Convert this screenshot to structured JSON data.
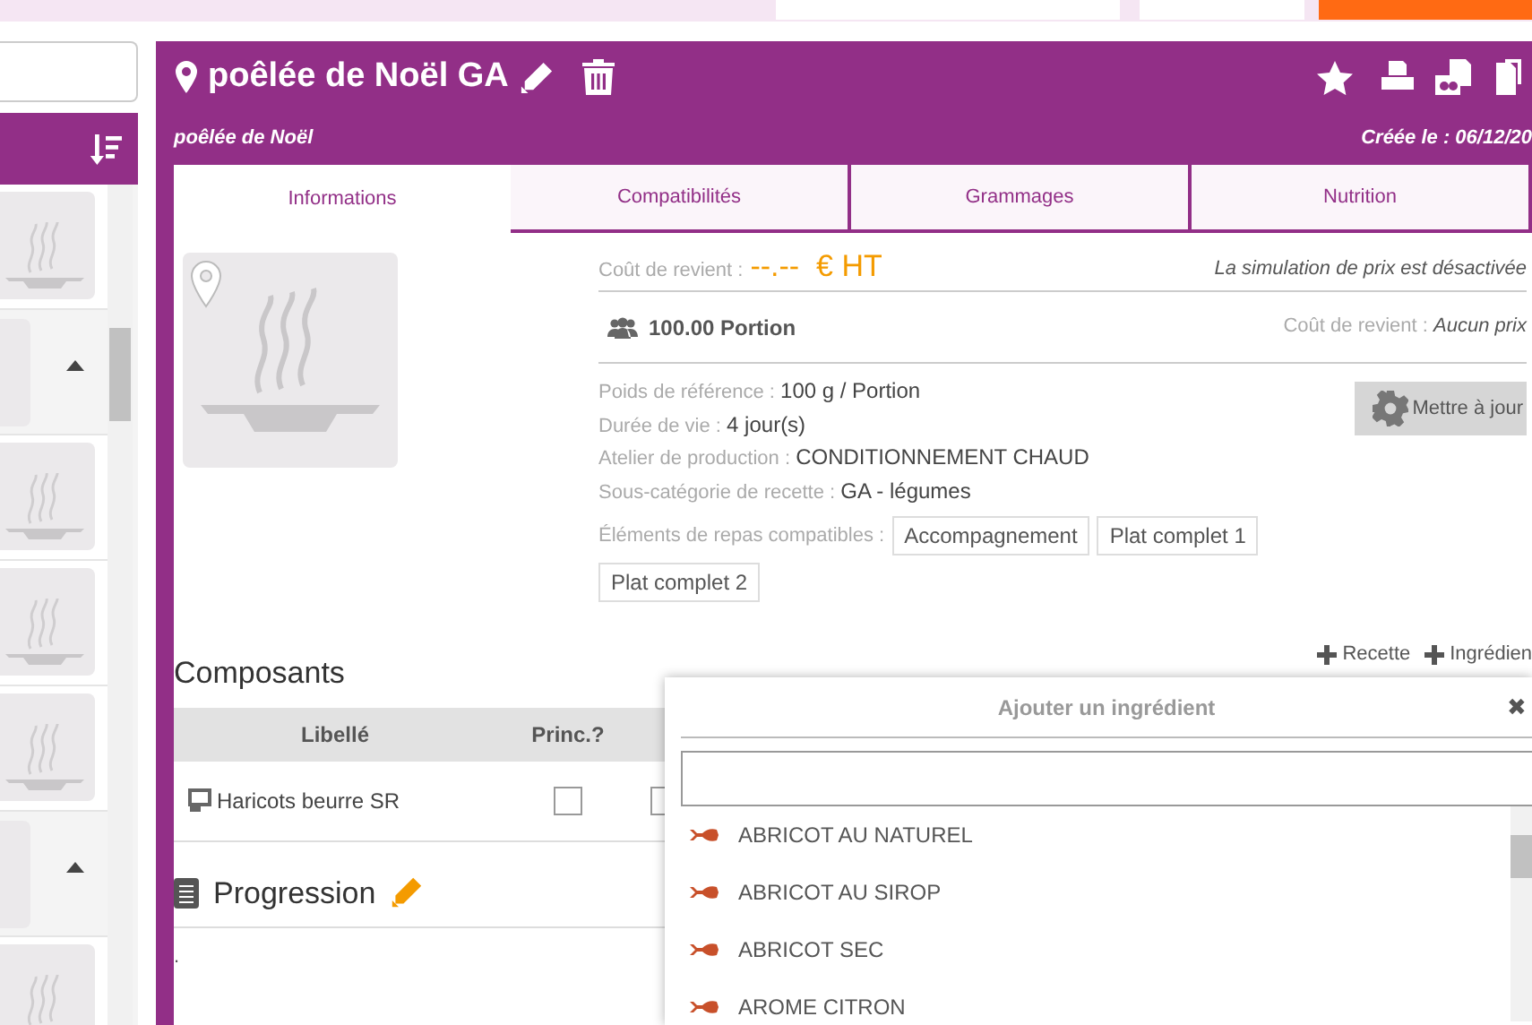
{
  "sidebar": {
    "items": [
      {
        "kind": "thumbnail"
      },
      {
        "kind": "group"
      },
      {
        "kind": "thumbnail"
      },
      {
        "kind": "thumbnail"
      },
      {
        "kind": "thumbnail"
      },
      {
        "kind": "group"
      },
      {
        "kind": "thumbnail"
      }
    ]
  },
  "recipe": {
    "title": "poêlée de Noël GA",
    "subtitle": "poêlée de Noël",
    "created": "Créée le : 06/12/20"
  },
  "tabs": [
    {
      "label": "Informations",
      "selected": true
    },
    {
      "label": "Compatibilités",
      "selected": false
    },
    {
      "label": "Grammages",
      "selected": false
    },
    {
      "label": "Nutrition",
      "selected": false
    }
  ],
  "cost": {
    "label": "Coût de revient :",
    "value": "--.--  € HT",
    "note": "La simulation de prix est désactivée"
  },
  "portion": {
    "value": "100.00 Portion",
    "cost_label": "Coût de revient :",
    "cost_value": "Aucun prix"
  },
  "details": [
    {
      "label": "Poids de référence :",
      "value": "100 g / Portion"
    },
    {
      "label": "Durée de vie :",
      "value": "4 jour(s)"
    },
    {
      "label": "Atelier de production :",
      "value": "CONDITIONNEMENT CHAUD"
    },
    {
      "label": "Sous-catégorie de recette :",
      "value": "GA - légumes"
    }
  ],
  "compatible": {
    "label": "Éléments de repas compatibles :",
    "tags": [
      "Accompagnement",
      "Plat complet 1",
      "Plat complet 2"
    ]
  },
  "update_button": "Mettre à jour",
  "components": {
    "title": "Composants",
    "actions": [
      "Recette",
      "Ingrédien"
    ],
    "columns": [
      "Libellé",
      "Princ.?"
    ],
    "rows": [
      {
        "label": "Haricots beurre SR",
        "principal": false,
        "column_3": false
      }
    ]
  },
  "progression": {
    "title": "Progression",
    "text": "."
  },
  "dialog": {
    "title": "Ajouter un ingrédient",
    "close": "✖",
    "items": [
      "ABRICOT AU NATUREL",
      "ABRICOT AU SIROP",
      "ABRICOT SEC",
      "AROME CITRON"
    ]
  }
}
